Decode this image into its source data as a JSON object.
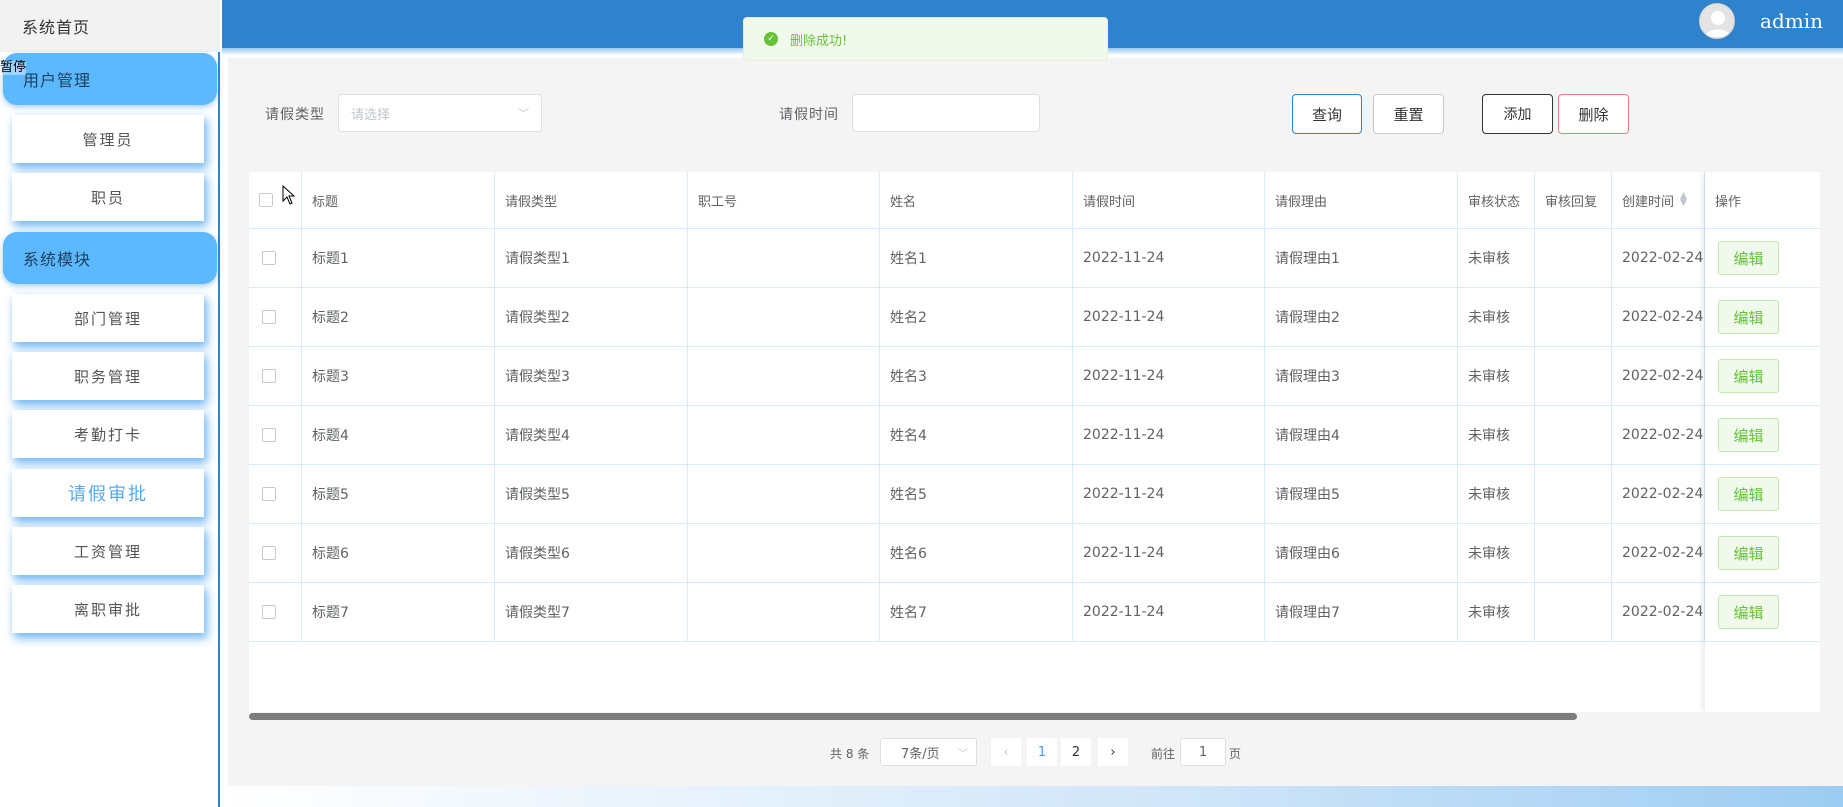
{
  "sidebar": {
    "home": "系统首页",
    "overlay": "暂停",
    "groups": [
      {
        "label": "用户管理",
        "items": [
          "管理员",
          "职员"
        ]
      },
      {
        "label": "系统模块",
        "items": [
          "部门管理",
          "职务管理",
          "考勤打卡",
          "请假审批",
          "工资管理",
          "离职审批"
        ]
      }
    ],
    "active_item": "请假审批"
  },
  "header": {
    "username": "admin",
    "avatar_icon": "user-avatar-icon",
    "accent_color": "#2f82cc"
  },
  "toast": {
    "message": "删除成功!",
    "icon": "check-circle-icon",
    "color": "#67c23a"
  },
  "filters": {
    "leave_type_label": "请假类型",
    "leave_type_placeholder": "请选择",
    "leave_time_label": "请假时间",
    "leave_time_value": ""
  },
  "buttons": {
    "query": "查询",
    "reset": "重置",
    "add": "添加",
    "delete": "删除"
  },
  "table": {
    "columns": [
      "标题",
      "请假类型",
      "职工号",
      "姓名",
      "请假时间",
      "请假理由",
      "审核状态",
      "审核回复",
      "创建时间",
      "操作"
    ],
    "edit_label": "编辑",
    "rows": [
      {
        "title": "标题1",
        "type": "请假类型1",
        "emp_no": "",
        "name": "姓名1",
        "leave_time": "2022-11-24",
        "reason": "请假理由1",
        "status": "未审核",
        "reply": "",
        "created": "2022-02-24"
      },
      {
        "title": "标题2",
        "type": "请假类型2",
        "emp_no": "",
        "name": "姓名2",
        "leave_time": "2022-11-24",
        "reason": "请假理由2",
        "status": "未审核",
        "reply": "",
        "created": "2022-02-24"
      },
      {
        "title": "标题3",
        "type": "请假类型3",
        "emp_no": "",
        "name": "姓名3",
        "leave_time": "2022-11-24",
        "reason": "请假理由3",
        "status": "未审核",
        "reply": "",
        "created": "2022-02-24"
      },
      {
        "title": "标题4",
        "type": "请假类型4",
        "emp_no": "",
        "name": "姓名4",
        "leave_time": "2022-11-24",
        "reason": "请假理由4",
        "status": "未审核",
        "reply": "",
        "created": "2022-02-24"
      },
      {
        "title": "标题5",
        "type": "请假类型5",
        "emp_no": "",
        "name": "姓名5",
        "leave_time": "2022-11-24",
        "reason": "请假理由5",
        "status": "未审核",
        "reply": "",
        "created": "2022-02-24"
      },
      {
        "title": "标题6",
        "type": "请假类型6",
        "emp_no": "",
        "name": "姓名6",
        "leave_time": "2022-11-24",
        "reason": "请假理由6",
        "status": "未审核",
        "reply": "",
        "created": "2022-02-24"
      },
      {
        "title": "标题7",
        "type": "请假类型7",
        "emp_no": "",
        "name": "姓名7",
        "leave_time": "2022-11-24",
        "reason": "请假理由7",
        "status": "未审核",
        "reply": "",
        "created": "2022-02-24"
      }
    ]
  },
  "pagination": {
    "total_text": "共 8 条",
    "page_size": "7条/页",
    "pages": [
      "1",
      "2"
    ],
    "current_page": "1",
    "goto_label": "前往",
    "goto_value": "1",
    "page_suffix": "页"
  }
}
